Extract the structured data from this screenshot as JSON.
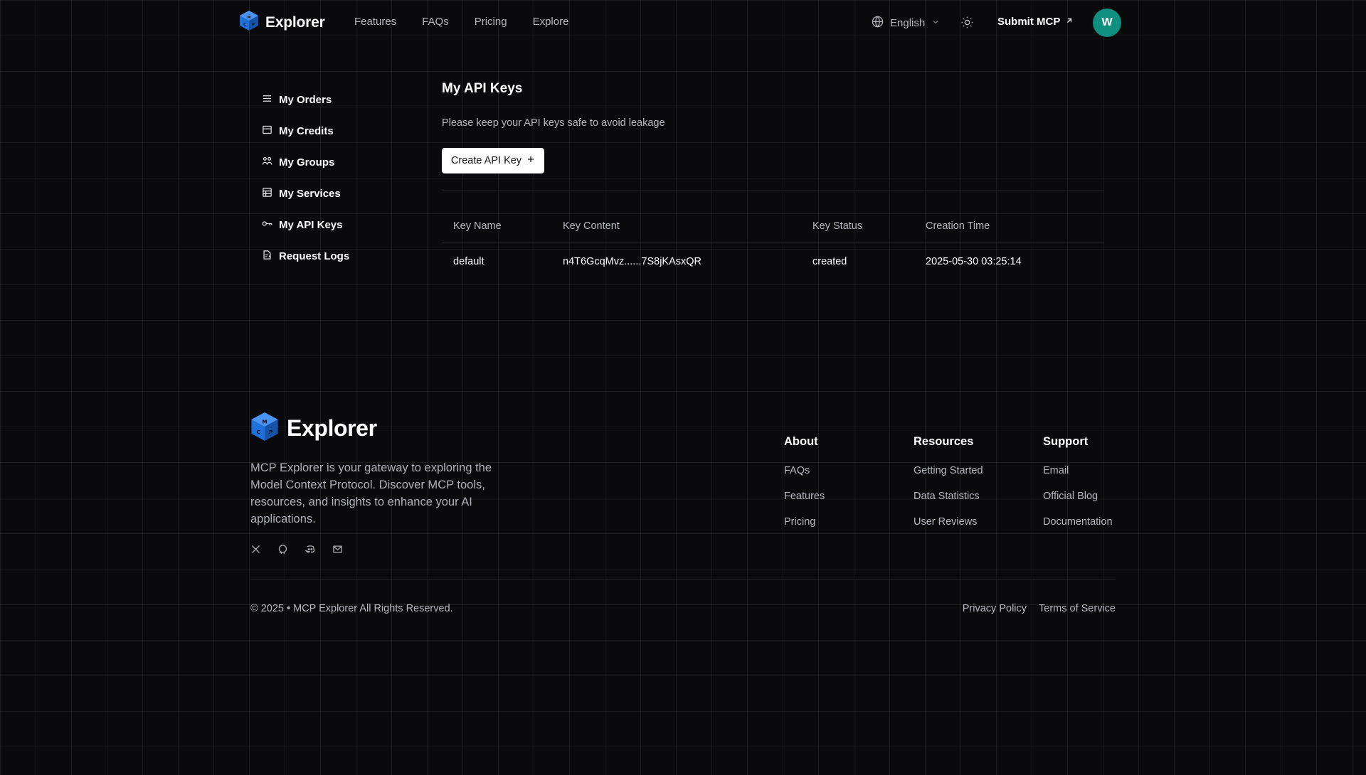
{
  "header": {
    "brand": "Explorer",
    "nav": [
      "Features",
      "FAQs",
      "Pricing",
      "Explore"
    ],
    "language": "English",
    "submit_label": "Submit MCP",
    "avatar_initial": "W"
  },
  "sidebar": {
    "items": [
      {
        "label": "My Orders",
        "icon": "list-icon"
      },
      {
        "label": "My Credits",
        "icon": "credit-card-icon"
      },
      {
        "label": "My Groups",
        "icon": "users-icon"
      },
      {
        "label": "My Services",
        "icon": "service-icon"
      },
      {
        "label": "My API Keys",
        "icon": "key-icon"
      },
      {
        "label": "Request Logs",
        "icon": "log-icon"
      }
    ]
  },
  "main": {
    "title": "My API Keys",
    "subtitle": "Please keep your API keys safe to avoid leakage",
    "create_button": "Create API Key",
    "table": {
      "headers": [
        "Key Name",
        "Key Content",
        "Key Status",
        "Creation Time"
      ],
      "rows": [
        [
          "default",
          "n4T6GcqMvz......7S8jKAsxQR",
          "created",
          "2025-05-30 03:25:14"
        ]
      ]
    }
  },
  "footer": {
    "brand": "Explorer",
    "description": "MCP Explorer is your gateway to exploring the Model Context Protocol. Discover MCP tools, resources, and insights to enhance your AI applications.",
    "social_icons": [
      "x-icon",
      "github-icon",
      "discord-icon",
      "mail-icon"
    ],
    "columns": [
      {
        "title": "About",
        "links": [
          "FAQs",
          "Features",
          "Pricing"
        ]
      },
      {
        "title": "Resources",
        "links": [
          "Getting Started",
          "Data Statistics",
          "User Reviews"
        ]
      },
      {
        "title": "Support",
        "links": [
          "Email",
          "Official Blog",
          "Documentation"
        ]
      }
    ],
    "copyright": "© 2025 • MCP Explorer All Rights Reserved.",
    "legal": [
      "Privacy Policy",
      "Terms of Service"
    ]
  },
  "colors": {
    "background": "#0a0a0c",
    "avatar": "#0f8f7f",
    "logo_blue": "#1e6fd9"
  }
}
